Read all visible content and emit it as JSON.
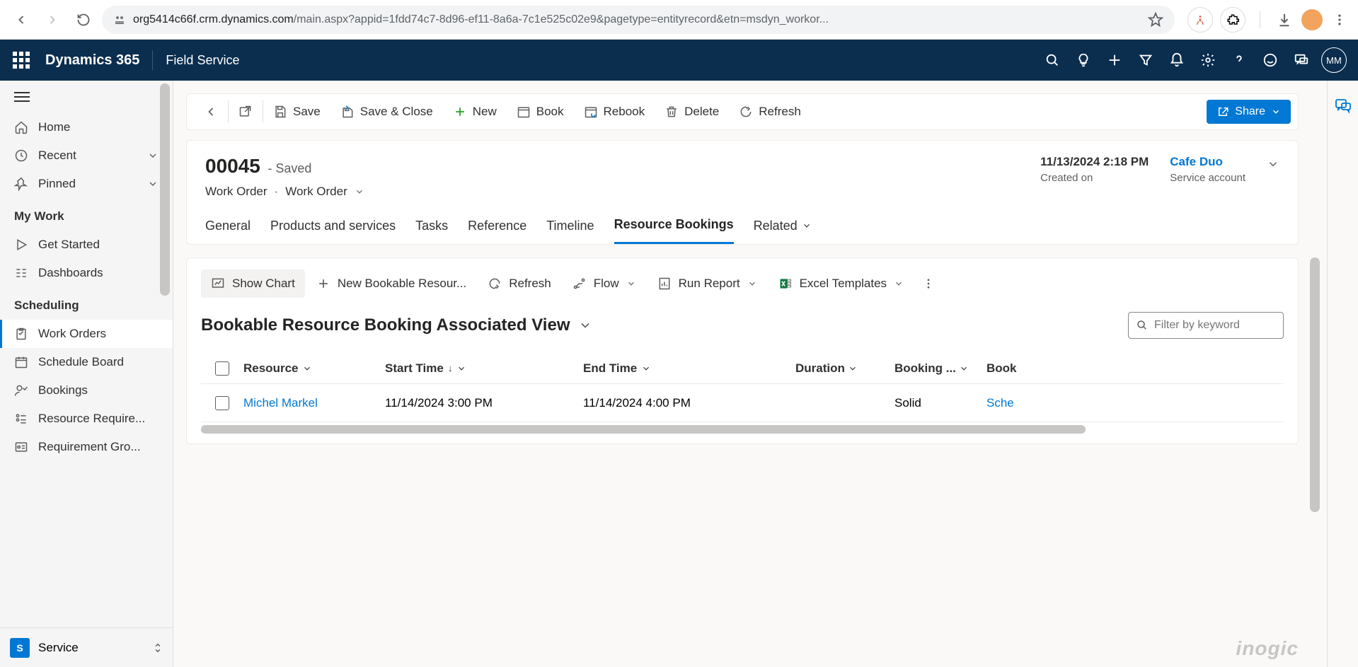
{
  "browser": {
    "url_domain": "org5414c66f.crm.dynamics.com",
    "url_path": "/main.aspx?appid=1fdd74c7-8d96-ef11-8a6a-7c1e525c02e9&pagetype=entityrecord&etn=msdyn_workor..."
  },
  "d365_header": {
    "brand": "Dynamics 365",
    "app_name": "Field Service",
    "avatar_initials": "MM"
  },
  "sidebar": {
    "home": "Home",
    "recent": "Recent",
    "pinned": "Pinned",
    "group_mywork": "My Work",
    "get_started": "Get Started",
    "dashboards": "Dashboards",
    "group_scheduling": "Scheduling",
    "work_orders": "Work Orders",
    "schedule_board": "Schedule Board",
    "bookings": "Bookings",
    "resource_require": "Resource Require...",
    "requirement_gro": "Requirement Gro...",
    "area_letter": "S",
    "area_label": "Service"
  },
  "cmdbar": {
    "save": "Save",
    "save_close": "Save & Close",
    "new": "New",
    "book": "Book",
    "rebook": "Rebook",
    "delete": "Delete",
    "refresh": "Refresh",
    "share": "Share"
  },
  "form_header": {
    "number": "00045",
    "state": "- Saved",
    "entity": "Work Order",
    "form_name": "Work Order",
    "created_on_val": "11/13/2024 2:18 PM",
    "created_on_lbl": "Created on",
    "account_val": "Cafe Duo",
    "account_lbl": "Service account"
  },
  "tabs": {
    "general": "General",
    "products": "Products and services",
    "tasks": "Tasks",
    "reference": "Reference",
    "timeline": "Timeline",
    "bookings": "Resource Bookings",
    "related": "Related"
  },
  "subgrid": {
    "show_chart": "Show Chart",
    "new": "New Bookable Resour...",
    "refresh": "Refresh",
    "flow": "Flow",
    "run_report": "Run Report",
    "excel_templates": "Excel Templates",
    "view_title": "Bookable Resource Booking Associated View",
    "filter_placeholder": "Filter by keyword"
  },
  "grid": {
    "columns": {
      "resource": "Resource",
      "start": "Start Time",
      "end": "End Time",
      "duration": "Duration",
      "booking_status": "Booking ...",
      "book": "Book"
    },
    "rows": [
      {
        "resource": "Michel Markel",
        "start": "11/14/2024 3:00 PM",
        "end": "11/14/2024 4:00 PM",
        "duration": "",
        "booking_status": "Solid",
        "book": "Sche"
      }
    ]
  },
  "watermark": "inogic"
}
